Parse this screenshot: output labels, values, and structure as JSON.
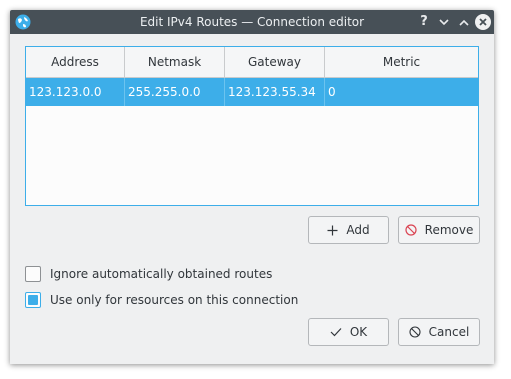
{
  "window": {
    "title": "Edit IPv4 Routes — Connection editor",
    "controls": {
      "help": "?",
      "minimize": "⌄",
      "maximize": "⌃",
      "close": "✕"
    }
  },
  "table": {
    "columns": [
      "Address",
      "Netmask",
      "Gateway",
      "Metric"
    ],
    "rows": [
      [
        "123.123.0.0",
        "255.255.0.0",
        "123.123.55.34",
        "0"
      ]
    ]
  },
  "buttons": {
    "add": "Add",
    "remove": "Remove",
    "ok": "OK",
    "cancel": "Cancel"
  },
  "options": {
    "ignore_routes": {
      "label": "Ignore automatically obtained routes",
      "checked": false
    },
    "use_only": {
      "label": "Use only for resources on this connection",
      "checked": true
    }
  },
  "colors": {
    "accent": "#3daee9",
    "titlebar": "#475057",
    "window_bg": "#eff0f1"
  },
  "icons": {
    "app": "network-globe-icon",
    "add": "plus-icon",
    "remove": "no-entry-icon",
    "ok": "checkmark-icon",
    "cancel": "cancel-circle-icon"
  }
}
